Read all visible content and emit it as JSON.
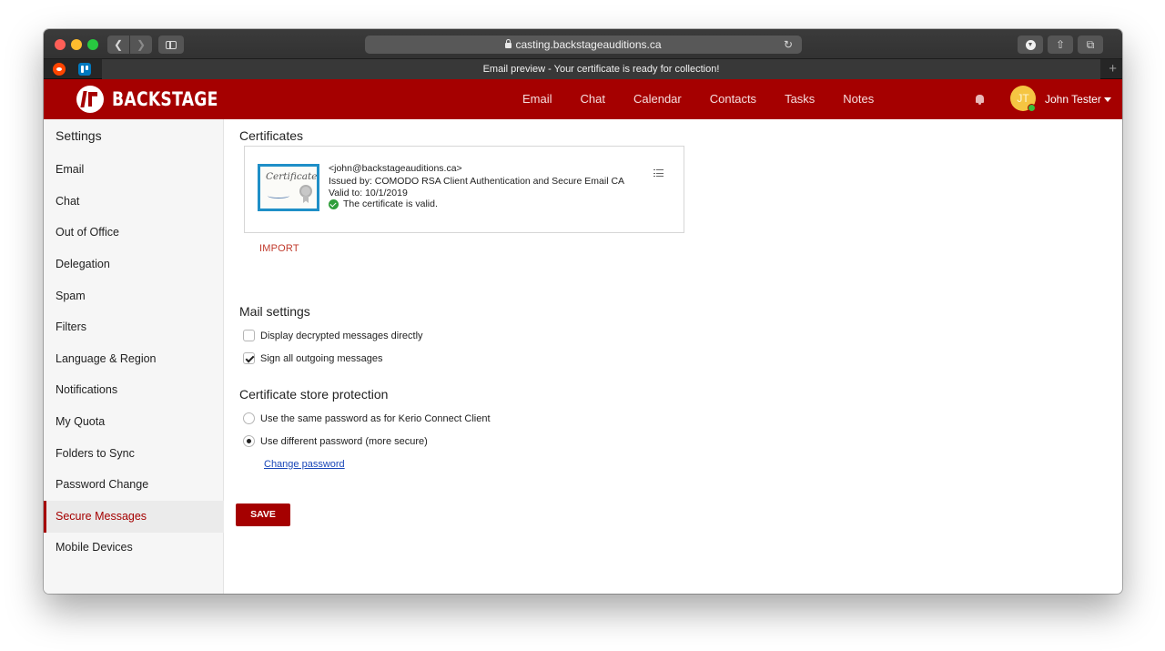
{
  "browser": {
    "url": "casting.backstageauditions.ca",
    "tab_title": "Email preview - Your certificate is ready for collection!",
    "new_tab_label": "+"
  },
  "header": {
    "brand": "BACKSTAGE",
    "nav": [
      "Email",
      "Chat",
      "Calendar",
      "Contacts",
      "Tasks",
      "Notes"
    ],
    "user": {
      "initials": "JT",
      "name": "John Tester"
    },
    "brand_color": "#a50000"
  },
  "settings": {
    "title": "Settings",
    "items": [
      "Email",
      "Chat",
      "Out of Office",
      "Delegation",
      "Spam",
      "Filters",
      "Language & Region",
      "Notifications",
      "My Quota",
      "Folders to Sync",
      "Password Change",
      "Secure Messages",
      "Mobile Devices"
    ],
    "active": "Secure Messages"
  },
  "certificates": {
    "heading": "Certificates",
    "image_text": "Certificate",
    "email": "<john@backstageauditions.ca>",
    "issued_by": "Issued by:  COMODO RSA Client Authentication and Secure Email CA",
    "valid_to": "Valid to:  10/1/2019",
    "status": "The certificate is valid.",
    "import_label": "IMPORT"
  },
  "mail_settings": {
    "heading": "Mail settings",
    "display_decrypted": {
      "label": "Display decrypted messages directly",
      "checked": false
    },
    "sign_outgoing": {
      "label": "Sign all outgoing messages",
      "checked": true
    }
  },
  "store_protection": {
    "heading": "Certificate store protection",
    "same_password": {
      "label": "Use the same password as for Kerio Connect Client",
      "selected": false
    },
    "different_password": {
      "label": "Use different password (more secure)",
      "selected": true
    },
    "change_password_label": "Change password"
  },
  "actions": {
    "save_label": "SAVE"
  }
}
